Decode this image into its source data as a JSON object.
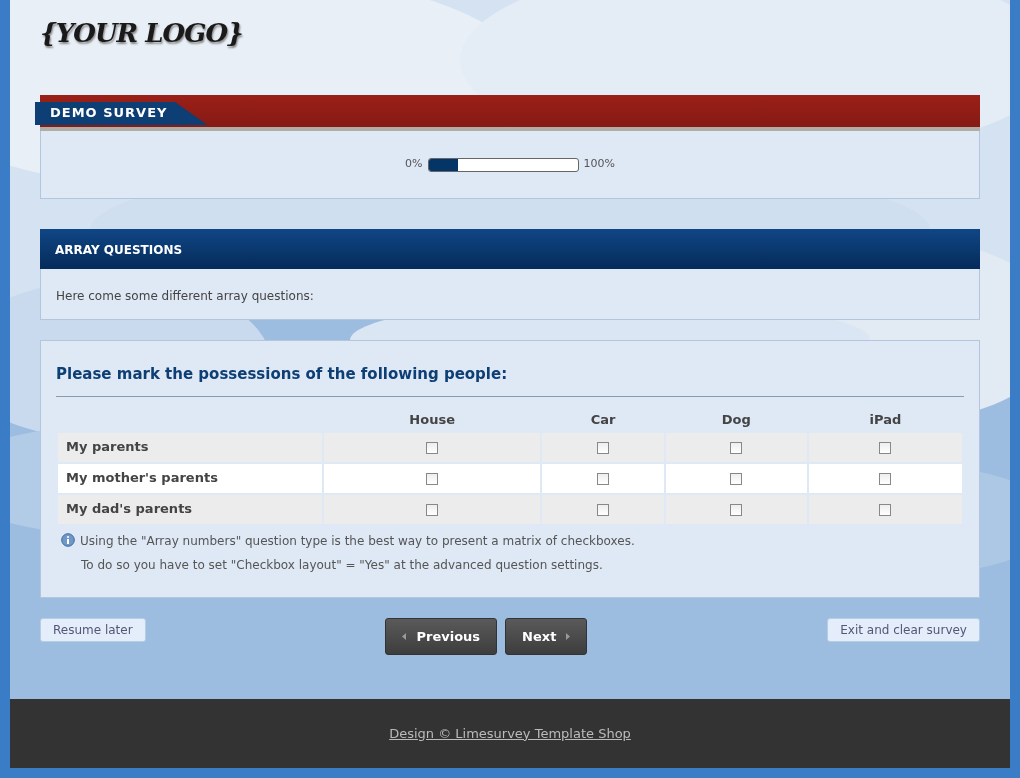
{
  "logo": "{YOUR LOGO}",
  "survey_title": "DEMO SURVEY",
  "progress": {
    "start_label": "0%",
    "end_label": "100%",
    "level": 0.2
  },
  "group": {
    "title": "ARRAY QUESTIONS",
    "description": "Here come some different array questions:"
  },
  "question": {
    "text": "Please mark the possessions of the following people:",
    "columns": [
      "House",
      "Car",
      "Dog",
      "iPad"
    ],
    "rows": [
      {
        "label": "My parents",
        "cells": [
          {
            "checked": false
          },
          {
            "checked": false
          },
          {
            "checked": false
          },
          {
            "checked": false
          }
        ]
      },
      {
        "label": "My mother's parents",
        "cells": [
          {
            "checked": false
          },
          {
            "checked": false
          },
          {
            "checked": false
          },
          {
            "checked": false
          }
        ]
      },
      {
        "label": "My dad's parents",
        "cells": [
          {
            "checked": false
          },
          {
            "checked": false
          },
          {
            "checked": false
          },
          {
            "checked": false
          }
        ]
      }
    ],
    "help": [
      "Using the \"Array numbers\" question type is the best way to present a matrix of checkboxes.",
      "To do so you have to set \"Checkbox layout\" = \"Yes\" at the advanced question settings."
    ]
  },
  "buttons": {
    "resume": "Resume later",
    "previous": "Previous",
    "next": "Next",
    "exit": "Exit and clear survey"
  },
  "footer": "Design © Limesurvey Template Shop"
}
